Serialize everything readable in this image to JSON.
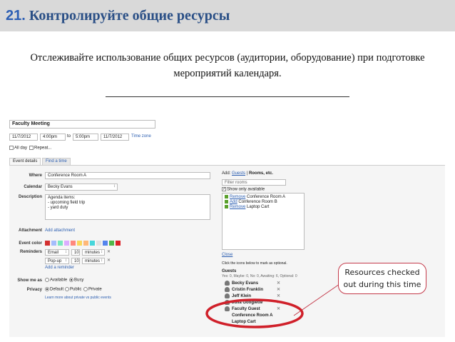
{
  "slide": {
    "title_number": "21.",
    "title_text": "Контролируйте общие ресурсы",
    "subtitle": "Отслеживайте использование общих ресурсов (аудитории, оборудование) при подготовке мероприятий календаря."
  },
  "event": {
    "title": "Faculty Meeting",
    "start_date": "11/7/2012",
    "start_time": "4:00pm",
    "to_label": "to",
    "end_time": "5:00pm",
    "end_date": "11/7/2012",
    "time_zone_link": "Time zone",
    "all_day_label": "All day",
    "repeat_label": "Repeat..."
  },
  "tabs": [
    {
      "label": "Event details"
    },
    {
      "label": "Find a time"
    }
  ],
  "details": {
    "where_label": "Where",
    "where_value": "Conference Room A",
    "calendar_label": "Calendar",
    "calendar_value": "Becky Evans",
    "description_label": "Description",
    "description_lines": [
      "Agenda items:",
      "- upcoming field trip",
      "- yard duty"
    ],
    "attachment_label": "Attachment",
    "attachment_link": "Add attachment",
    "event_color_label": "Event color",
    "colors": [
      "#d32f2f",
      "#a4bdfc",
      "#7ae7bf",
      "#dbadff",
      "#ff887c",
      "#fbd75b",
      "#ffb878",
      "#46d6db",
      "#e1e1e1",
      "#5484ed",
      "#51b749",
      "#dc2127"
    ],
    "reminders_label": "Reminders",
    "reminders": [
      {
        "method": "Email",
        "value": "10",
        "unit": "minutes"
      },
      {
        "method": "Pop-up",
        "value": "10",
        "unit": "minutes"
      }
    ],
    "add_reminder_link": "Add a reminder",
    "show_me_as_label": "Show me as",
    "show_options": [
      "Available",
      "Busy"
    ],
    "privacy_label": "Privacy",
    "privacy_options": [
      "Default",
      "Public",
      "Private"
    ],
    "learn_more_link": "Learn more about private vs public events"
  },
  "side": {
    "add_label": "Add:",
    "guests_tab": "Guests",
    "separator": "|",
    "rooms_tab": "Rooms, etc.",
    "filter_placeholder": "Filter rooms",
    "show_available_label": "Show only available",
    "rooms": [
      {
        "action": "Remove",
        "name": "Conference Room A"
      },
      {
        "action": "Add",
        "name": "Conference Room B"
      },
      {
        "action": "Remove",
        "name": "Laptop Cart"
      }
    ],
    "close_link": "Close",
    "optional_hint": "Click the icons below to mark as optional.",
    "guests_heading": "Guests",
    "guests_rsvp": "Yes: 0, Maybe: 0, No: 0, Awaiting: 6, Optional: 0",
    "guest_list": [
      "Becky Evans",
      "Cristin Franklin",
      "Jeff Klein",
      "Julia Googlette",
      "Faculty Guest"
    ],
    "resource_list": [
      "Conference Room A",
      "Laptop Cart"
    ]
  },
  "callout": {
    "line1": "Resources checked",
    "line2": "out during this time",
    "border_color": "#c43a4a",
    "ellipse_color": "#d0202a"
  }
}
